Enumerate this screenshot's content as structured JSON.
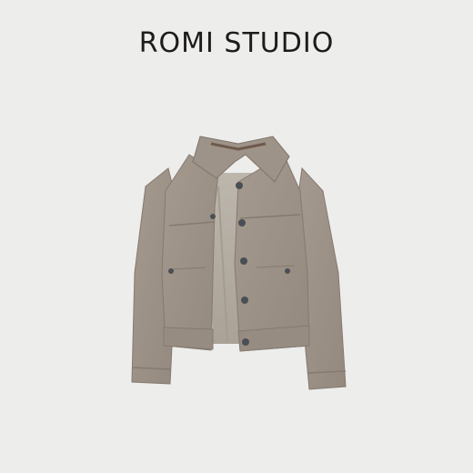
{
  "brand": {
    "name": "ROMI STUDIO"
  },
  "product": {
    "image_icon": "suede-trucker-jacket-photo",
    "colors": {
      "background": "#ededec",
      "suede": "#a09589",
      "suede_dark": "#8b8075",
      "lining": "#b7b0a6",
      "button": "#4a4f55"
    }
  }
}
